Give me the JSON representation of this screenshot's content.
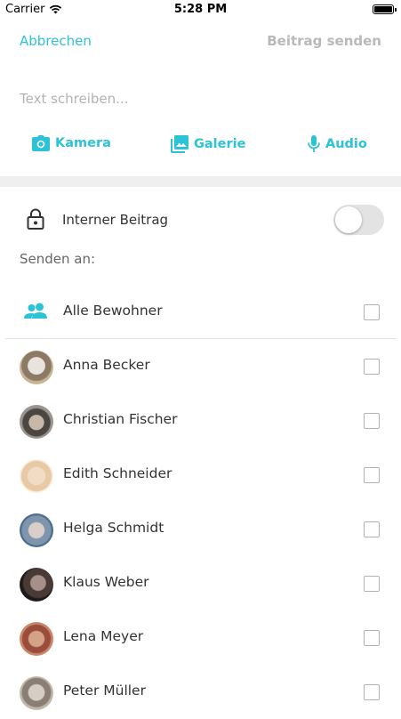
{
  "status_bar": {
    "carrier": "Carrier",
    "time": "5:28 PM"
  },
  "header": {
    "cancel_label": "Abbrechen",
    "send_label": "Beitrag senden"
  },
  "compose": {
    "placeholder": "Text schreiben..."
  },
  "media": [
    {
      "label": "Kamera",
      "icon": "camera-icon"
    },
    {
      "label": "Galerie",
      "icon": "gallery-icon"
    },
    {
      "label": "Audio",
      "icon": "microphone-icon"
    }
  ],
  "internal": {
    "label": "Interner Beitrag",
    "enabled": false
  },
  "send_to_label": "Senden an:",
  "all_residents": {
    "label": "Alle Bewohner",
    "checked": false
  },
  "recipients": [
    {
      "name": "Anna Becker",
      "checked": false
    },
    {
      "name": "Christian Fischer",
      "checked": false
    },
    {
      "name": "Edith Schneider",
      "checked": false
    },
    {
      "name": "Helga Schmidt",
      "checked": false
    },
    {
      "name": "Klaus Weber",
      "checked": false
    },
    {
      "name": "Lena Meyer",
      "checked": false
    },
    {
      "name": "Peter Müller",
      "checked": false
    }
  ],
  "colors": {
    "accent": "#2cc3d6",
    "disabled": "#b9b9b9",
    "band": "#efefef"
  }
}
